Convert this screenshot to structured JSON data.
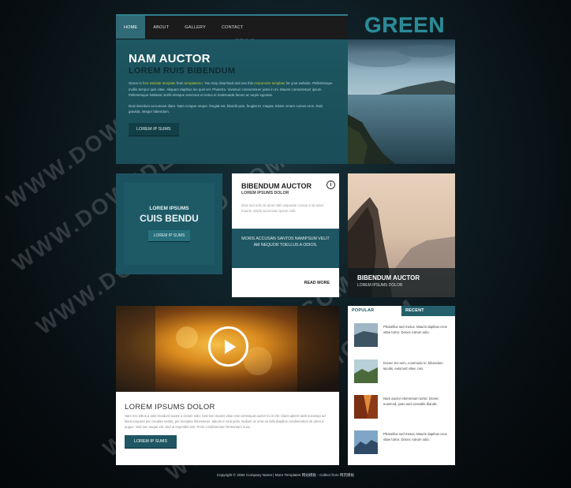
{
  "nav": {
    "items": [
      "HOME",
      "ABOUT",
      "GALLERY",
      "CONTACT"
    ],
    "active": "HOME"
  },
  "logo": "GREEN",
  "hero": {
    "title": "NAM AUCTOR",
    "subtitle": "LOREM RUIS BIBENDUM",
    "para1_a": "Green is ",
    "para1_link1": "free website template",
    "para1_b": " from ",
    "para1_link2": "templatemo",
    "para1_c": ". You may download and use this ",
    "para1_link3": "responsive template",
    "para1_d": " for your website. Pellentesque mollis tempor quis vitae. Aliquam dapibus leo quis vel. Pharetra. Vivamus consectetuer justo in mi. Mauris consectetuer ipsum. Pellentesque habitant morbi tristique senectus et netus et malesuada fames ac turpis egestas.",
    "para2": "Duis interdum accumsan diam. Nam congue neque. feugiat est, blandit quis, feugiat et, magna. Etiam ornare cursus eros. Duis gravida, integer bibendum.",
    "button": "LOREM IP SUMS"
  },
  "teal_box": {
    "line1": "LOREM IPSUMS",
    "line2": "CUIS BENDU",
    "button": "LOREM IP SUMS"
  },
  "card": {
    "title": "BIBENDUM AUCTOR",
    "subtitle": "LOREM IPSUMS DOLOR",
    "body": "Duis sed odio sit amet nibh vulputate cursus a sit amet mauris. Morbi accumsan ipsum velit.",
    "info_icon": "i",
    "mid_text": "MORIS ACCUSAN SANTOS NAMIPSUM VELIT AM NEQUOR TOELLUS A ODIOS.",
    "read_more": "READ MORE"
  },
  "mountain": {
    "title": "BIBENDUM AUCTOR",
    "subtitle": "LOREM IPSUMS DOLOR"
  },
  "lorem": {
    "title": "LOREM IPSUMS DOLOR",
    "body": "Nam nec tellus a odio tincidunt auctor a ornare odio. Sed non mauris vitae erat consequat auctor eu in elit. Class aptent taciti sociosqu ad litora torquent per conubia nostra, per inceptos himenaeos. Mauris in erat justo. Nullam ac urna eu felis dapibus condimentum sit amet a augue. Sed non neque elit. Sed ut imperdiet nisi. Proin condimentum fermentum nunc.",
    "button": "LOREM IP SUMS"
  },
  "side": {
    "tab_popular": "POPULAR",
    "tab_recent": "RECENT",
    "items": [
      {
        "text": "Phasellus sed metus. Mauris dapibus eros vitae tortor. Donec rutrum odio."
      },
      {
        "text": "Donec leo sem, commodo in, bibendum iaculis, euismod vitae, nisi."
      },
      {
        "text": "Nam auctor elementum tortor. Donec euismod, justo sed convallis blandit."
      },
      {
        "text": "Phasellus sed metus. Mauris dapibus eros vitae tortor. Donec rutrum odio."
      }
    ]
  },
  "footer": "Copyright © 2084 Company Name | More Templates 网站模板 - Collect from 网页模板",
  "watermark": "WWW.DOWNDEMO.COM",
  "colors": {
    "accent": "#2f7f8c",
    "dark_teal": "#1f5663",
    "logo": "#2c8a97"
  }
}
